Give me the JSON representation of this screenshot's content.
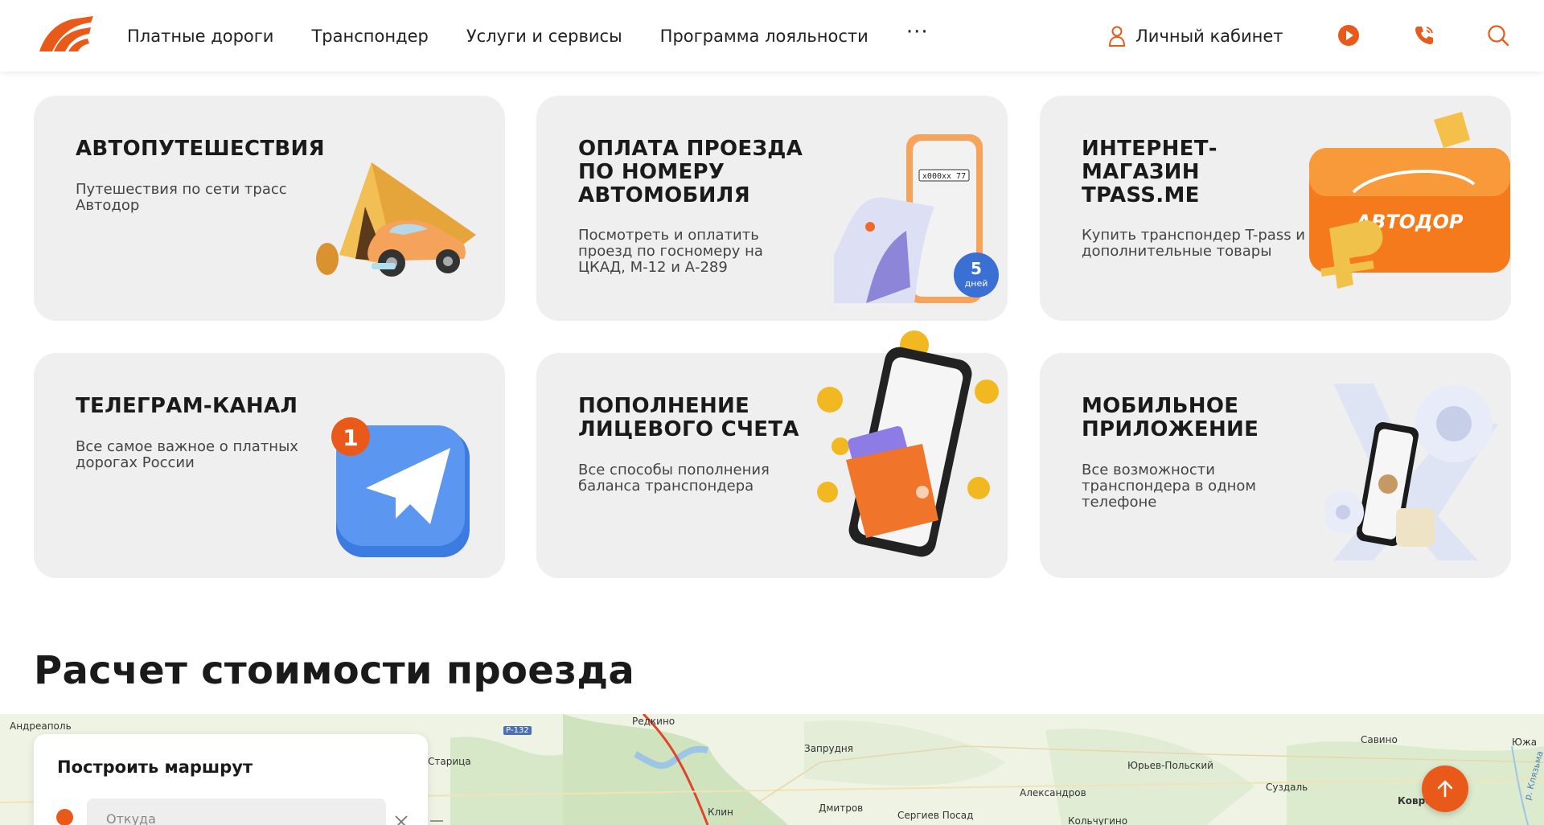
{
  "brand": {
    "accent": "#e95a1a"
  },
  "header": {
    "nav": [
      {
        "label": "Платные дороги"
      },
      {
        "label": "Транспондер"
      },
      {
        "label": "Услуги и сервисы"
      },
      {
        "label": "Программа лояльности"
      }
    ],
    "more_label": "···",
    "account_label": "Личный кабинет",
    "icons": [
      "user-icon",
      "play-icon",
      "phone-icon",
      "search-icon"
    ]
  },
  "cards": [
    {
      "title": "Автопутешествия",
      "desc": "Путешествия по сети трасс Автодор",
      "art": "tent-car-illustration"
    },
    {
      "title": "Оплата проезда по номеру автомобиля",
      "desc": "Посмотреть и оплатить проезд по госномеру на ЦКАД, М-12 и А-289",
      "art": "phone-receipt-illustration",
      "badge_num": "5",
      "badge_text": "дней",
      "plate": "х000хх 77"
    },
    {
      "title": "Интернет-магазин TPASS.ME",
      "desc": "Купить транспондер T-pass и дополнительные товары",
      "art": "transponder-ruble-illustration",
      "brand_on_card": "АВТОДОР"
    },
    {
      "title": "Телеграм-канал",
      "desc": "Все самое важное о платных дорогах России",
      "art": "telegram-illustration",
      "badge_num": "1"
    },
    {
      "title": "Пополнение лицевого счета",
      "desc": "Все способы пополнения баланса транспондера",
      "art": "wallet-phone-illustration"
    },
    {
      "title": "Мобильное приложение",
      "desc": "Все возможности транспондера в одном телефоне",
      "art": "mobile-app-illustration"
    }
  ],
  "calc": {
    "title": "Расчет стоимости проезда",
    "route_title": "Построить маршрут",
    "from_placeholder": "Откуда"
  },
  "map": {
    "labels": [
      "Андреаполь",
      "Р-132",
      "Редкино",
      "Старица",
      "Запрудня",
      "Юрьев-Польский",
      "Савино",
      "Южа",
      "Александров",
      "Суздаль",
      "Клин",
      "Дмитров",
      "Сергиев Посад",
      "Кольчугино",
      "Ковров",
      "р. Клязьма"
    ]
  }
}
